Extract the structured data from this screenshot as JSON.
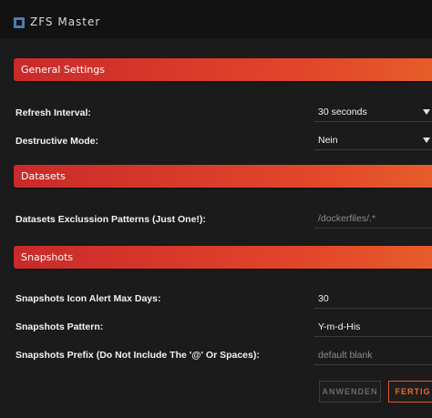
{
  "window": {
    "title": "ZFS Master",
    "icon": "zfs-master-app-icon"
  },
  "sections": {
    "general": "General Settings",
    "datasets": "Datasets",
    "snapshots": "Snapshots"
  },
  "general": {
    "refresh_interval": {
      "label": "Refresh Interval:",
      "value": "30 seconds"
    },
    "destructive_mode": {
      "label": "Destructive Mode:",
      "value": "Nein"
    }
  },
  "datasets": {
    "exclusion_patterns": {
      "label": "Datasets Exclussion Patterns (Just One!):",
      "placeholder": "/dockerfiles/.*"
    }
  },
  "snapshots": {
    "icon_alert_max_days": {
      "label": "Snapshots Icon Alert Max Days:",
      "value": "30"
    },
    "pattern": {
      "label": "Snapshots Pattern:",
      "value": "Y-m-d-His"
    },
    "prefix": {
      "label": "Snapshots Prefix (Do Not Include The '@' Or Spaces):",
      "placeholder": "default blank"
    }
  },
  "buttons": {
    "apply": "ANWENDEN",
    "done": "FERTIG"
  },
  "colors": {
    "accent": "#e2462a",
    "background": "#1c1b1b",
    "titlebar": "#121212"
  }
}
